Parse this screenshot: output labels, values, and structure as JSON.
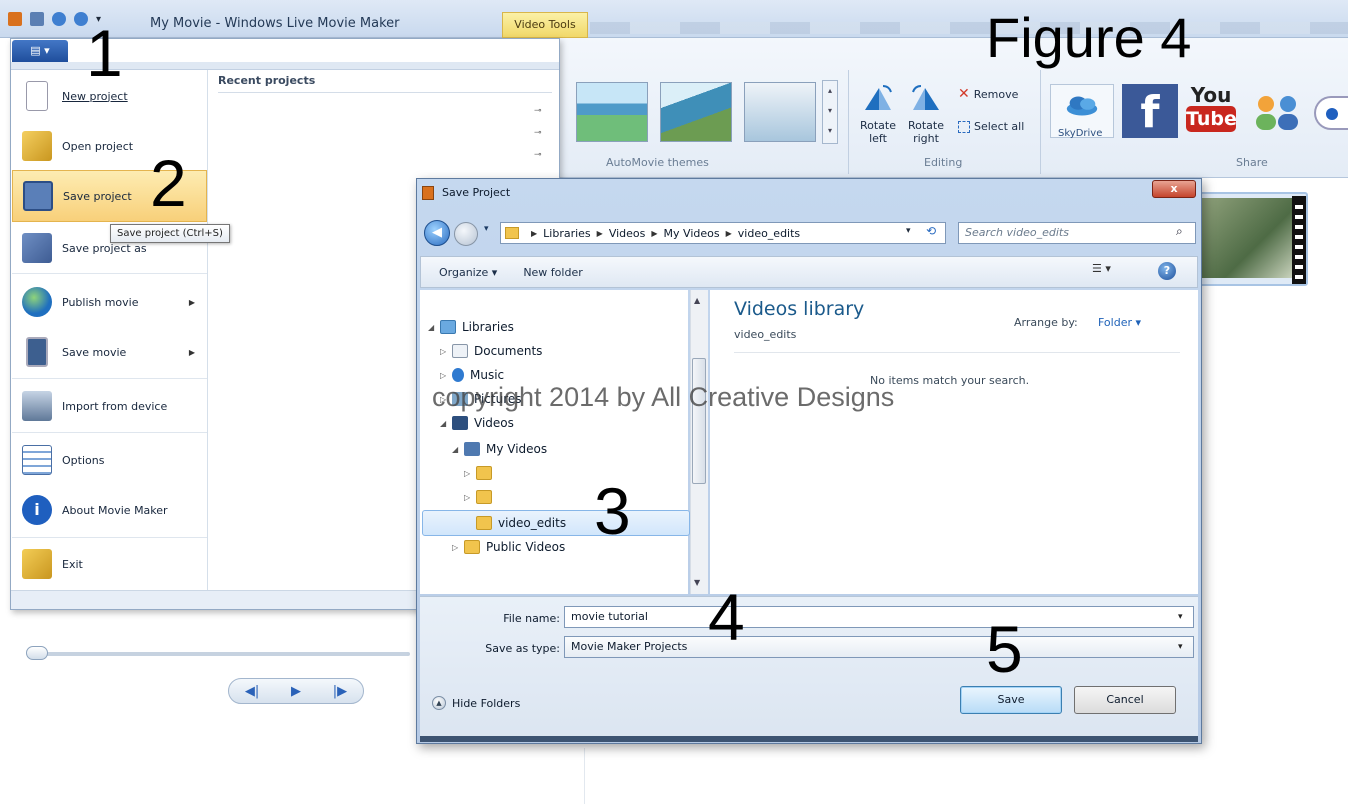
{
  "app": {
    "title": "My Movie - Windows Live Movie Maker",
    "context_tab": "Video Tools"
  },
  "figure_label": "Figure 4",
  "ribbon": {
    "automovie_group": "AutoMovie themes",
    "editing_group": "Editing",
    "share_group": "Share",
    "rotate_left": "Rotate left",
    "rotate_right": "Rotate right",
    "remove": "Remove",
    "select_all": "Select all",
    "skydrive": "SkyDrive",
    "facebook_glyph": "f",
    "youtube_top": "You",
    "youtube_bottom": "Tube"
  },
  "file_menu": {
    "recent_title": "Recent projects",
    "items": [
      {
        "label": "New project",
        "icon": "new-project-icon"
      },
      {
        "label": "Open project",
        "icon": "open-project-icon"
      },
      {
        "label": "Save project",
        "icon": "save-project-icon"
      },
      {
        "label": "Save project as",
        "icon": "save-project-as-icon"
      },
      {
        "label": "Publish movie",
        "icon": "publish-movie-icon"
      },
      {
        "label": "Save movie",
        "icon": "save-movie-icon"
      },
      {
        "label": "Import from device",
        "icon": "import-device-icon"
      },
      {
        "label": "Options",
        "icon": "options-icon"
      },
      {
        "label": "About Movie Maker",
        "icon": "about-icon"
      },
      {
        "label": "Exit",
        "icon": "exit-icon"
      }
    ],
    "tooltip": "Save project (Ctrl+S)"
  },
  "step_numbers": [
    "1",
    "2",
    "3",
    "4",
    "5"
  ],
  "dialog": {
    "title": "Save Project",
    "close": "x",
    "breadcrumb": [
      "Libraries",
      "Videos",
      "My Videos",
      "video_edits"
    ],
    "search_placeholder": "Search video_edits",
    "organize": "Organize ▾",
    "new_folder": "New folder",
    "tree": {
      "libraries": "Libraries",
      "documents": "Documents",
      "music": "Music",
      "pictures": "Pictures",
      "videos": "Videos",
      "my_videos": "My Videos",
      "video_edits": "video_edits",
      "public_videos": "Public Videos"
    },
    "library_title": "Videos library",
    "library_sub": "video_edits",
    "arrange_label": "Arrange by:",
    "arrange_value": "Folder ▾",
    "empty_message": "No items match your search.",
    "file_name_label": "File name:",
    "file_name_value": "movie tutorial",
    "save_type_label": "Save as type:",
    "save_type_value": "Movie Maker Projects",
    "hide_folders": "Hide Folders",
    "save": "Save",
    "cancel": "Cancel"
  },
  "watermark": "copyright 2014 by All Creative Designs",
  "colors": {
    "accent": "#2a6bc0",
    "highlight": "#f8d07a",
    "library_title": "#1b5a8b"
  }
}
